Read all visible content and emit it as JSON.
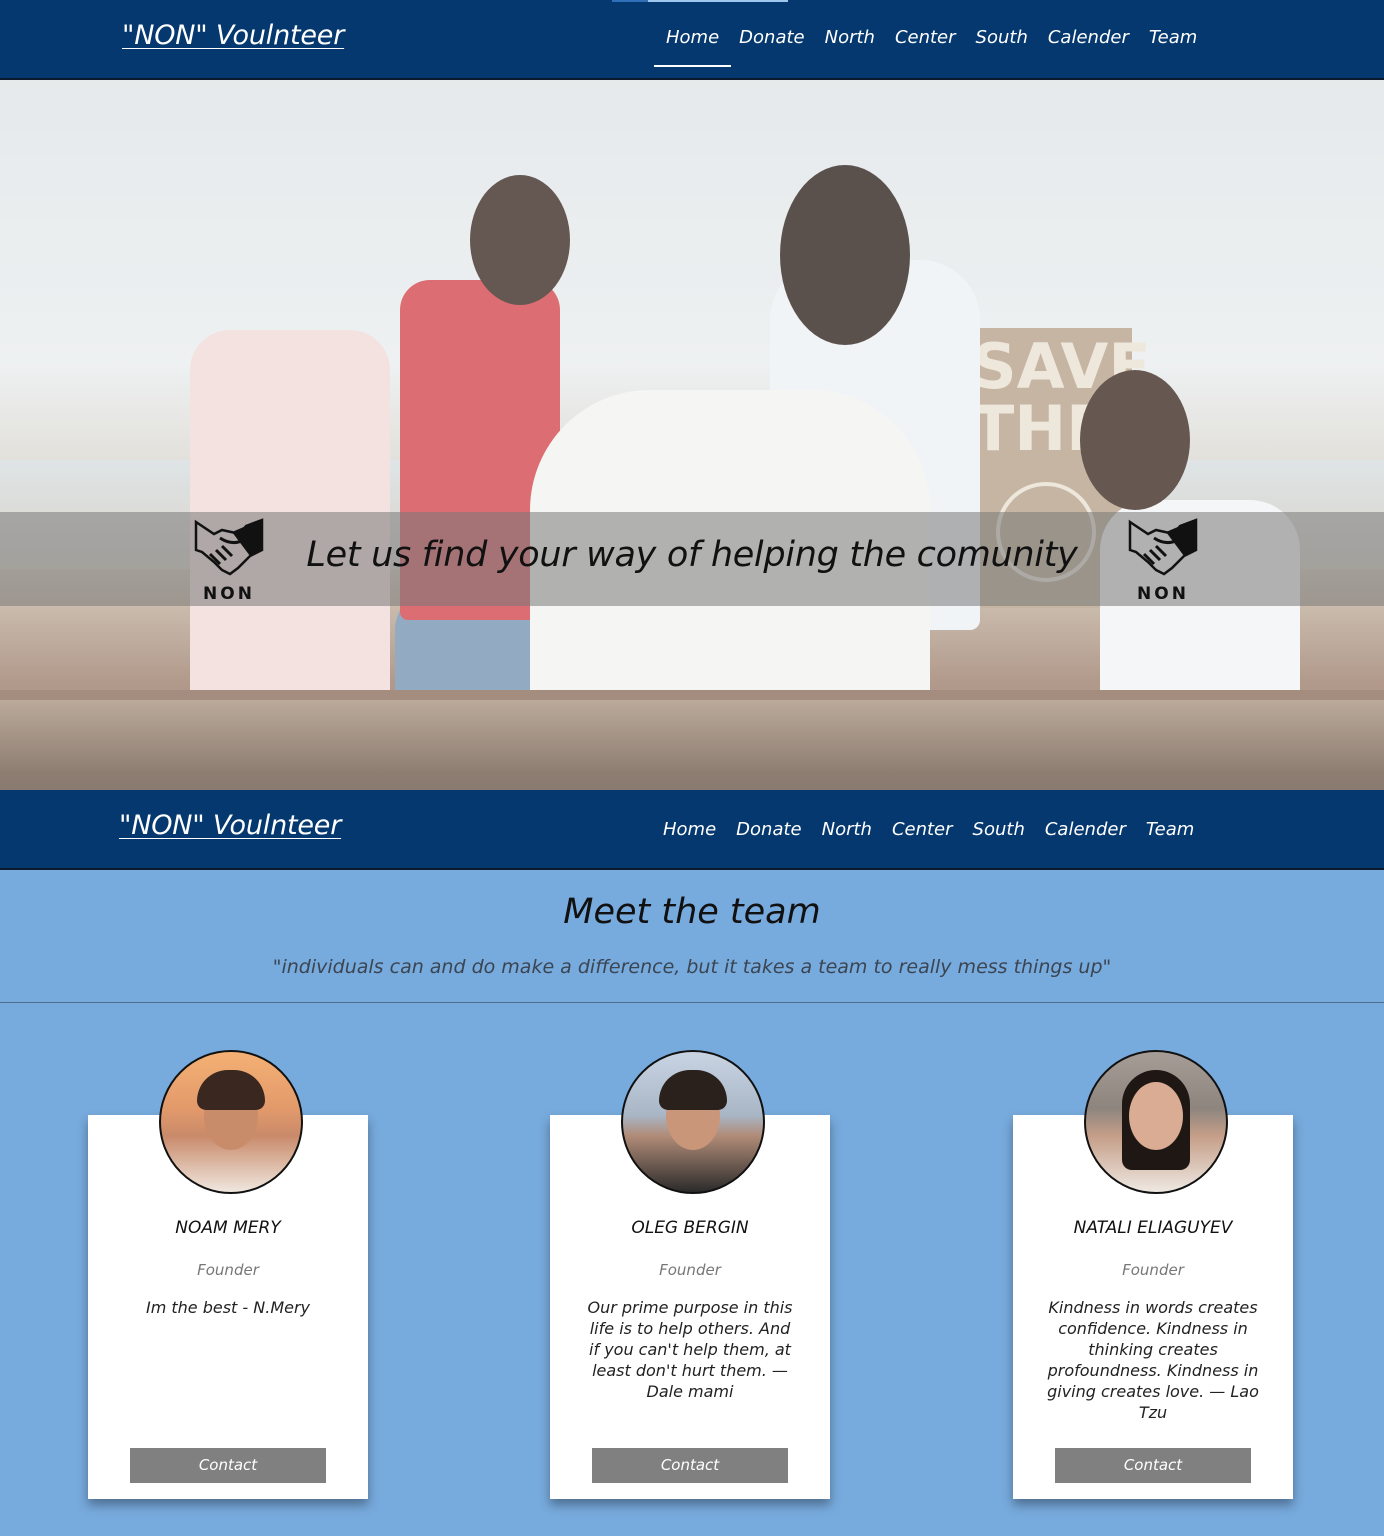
{
  "brand": "\"NON\" Voulnteer",
  "nav": {
    "items": [
      "Home",
      "Donate",
      "North",
      "Center",
      "South",
      "Calender",
      "Team"
    ],
    "active": "Home"
  },
  "hero": {
    "tagline": "Let us find your way of helping the comunity",
    "sign_text": "SAVE THE",
    "logo_text": "NON"
  },
  "team": {
    "title": "Meet the team",
    "quote": "\"individuals can and do make a difference, but it takes a team to really mess things up\"",
    "members": [
      {
        "name": "NOAM MERY",
        "role": "Founder",
        "quote": "Im the best - N.Mery",
        "button": "Contact"
      },
      {
        "name": "OLEG BERGIN",
        "role": "Founder",
        "quote": "Our prime purpose in this life is to help others. And if you can't help them, at least don't hurt them. — Dale mami",
        "button": "Contact"
      },
      {
        "name": "NATALI ELIAGUYEV",
        "role": "Founder",
        "quote": "Kindness in words creates confidence. Kindness in thinking creates profoundness. Kindness in giving creates love. — Lao Tzu",
        "button": "Contact"
      }
    ]
  },
  "colors": {
    "nav_bg": "#04386f",
    "page_bg": "#77aadd",
    "button_bg": "#808080"
  }
}
